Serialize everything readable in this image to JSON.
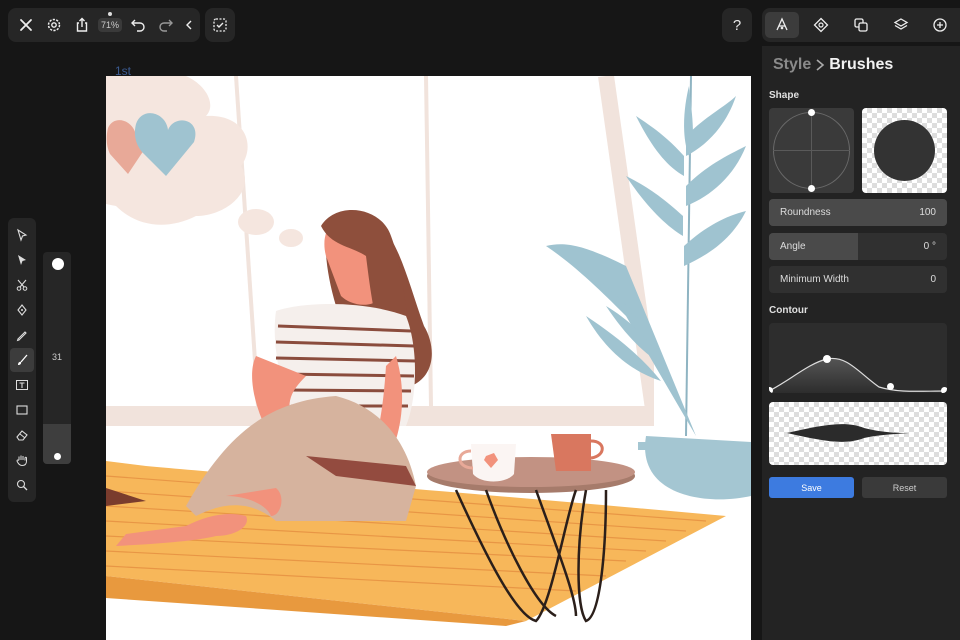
{
  "toolbar": {
    "zoom": "71%",
    "left_icons": [
      "close-icon",
      "gear-icon",
      "share-icon",
      "zoom-indicator",
      "undo-icon",
      "redo-icon",
      "chevron-left-icon"
    ],
    "selection_icon": "dashed-check-icon",
    "help": "?"
  },
  "canvas": {
    "layer_name": "1st"
  },
  "tools": [
    "select-arrow-icon",
    "direct-select-icon",
    "scissors-icon",
    "pen-icon",
    "pencil-icon",
    "brush-icon",
    "text-icon",
    "rectangle-icon",
    "eraser-icon",
    "hand-icon",
    "zoom-icon"
  ],
  "active_tool": "brush-icon",
  "brush_size": {
    "value": "31",
    "level": 0.19
  },
  "panel_tabs": [
    "style-tab-icon",
    "fill-tab-icon",
    "arrange-tab-icon",
    "layers-tab-icon",
    "add-tab-icon"
  ],
  "panel": {
    "breadcrumb_parent": "Style",
    "breadcrumb_current": "Brushes",
    "shape_label": "Shape",
    "contour_label": "Contour",
    "props": [
      {
        "label": "Roundness",
        "value": "100",
        "level": 1.0
      },
      {
        "label": "Angle",
        "value": "0 °",
        "level": 0.5
      },
      {
        "label": "Minimum Width",
        "value": "0",
        "level": 0
      }
    ],
    "save": "Save",
    "reset": "Reset"
  },
  "colors": {
    "accent": "#3d7be0",
    "canvas": "#ffffff",
    "panel": "#232323",
    "background": "#161616"
  }
}
